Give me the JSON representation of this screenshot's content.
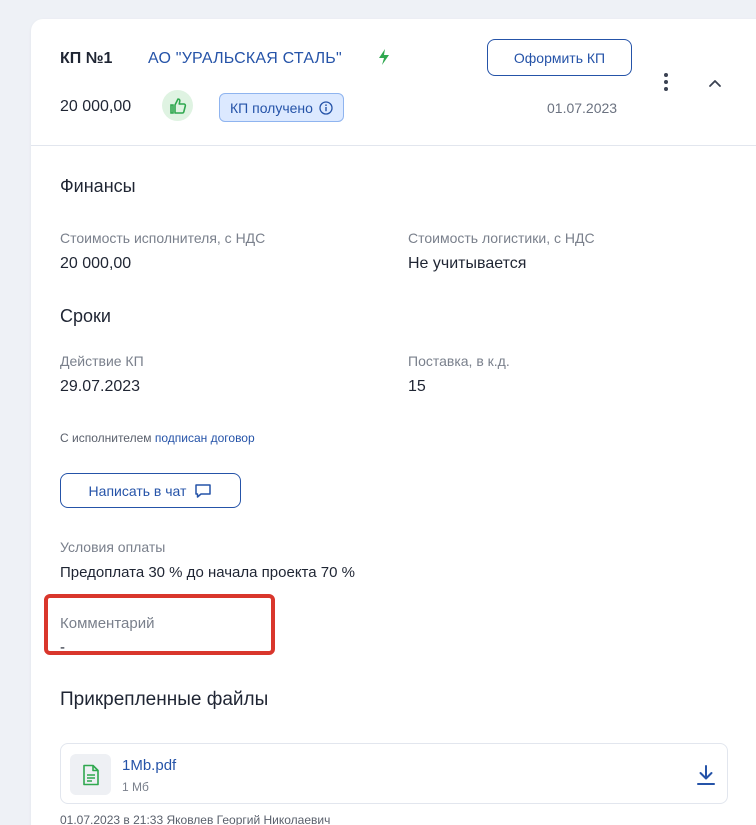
{
  "header": {
    "kp_title": "КП №1",
    "company": "АО \"УРАЛЬСКАЯ СТАЛЬ\"",
    "issue_button": "Оформить КП",
    "price": "20 000,00",
    "status": "КП получено",
    "date": "01.07.2023"
  },
  "finances": {
    "title": "Финансы",
    "executor_cost_label": "Стоимость исполнителя, с НДС",
    "executor_cost_value": "20 000,00",
    "logistics_cost_label": "Стоимость логистики, с НДС",
    "logistics_cost_value": "Не учитывается"
  },
  "terms": {
    "title": "Сроки",
    "validity_label": "Действие КП",
    "validity_value": "29.07.2023",
    "delivery_label": "Поставка, в к.д.",
    "delivery_value": "15",
    "contract_note_prefix": "С исполнителем",
    "contract_note_link": "подписан договор"
  },
  "chat_button": "Написать в чат",
  "payment": {
    "label": "Условия оплаты",
    "value": "Предоплата 30 % до начала проекта 70 %"
  },
  "comment": {
    "label": "Комментарий",
    "value": "-"
  },
  "files": {
    "title": "Прикрепленные файлы",
    "items": [
      {
        "name": "1Mb.pdf",
        "size": "1 Мб",
        "meta": "01.07.2023 в 21:33  Яковлев Георгий Николаевич"
      }
    ]
  },
  "colors": {
    "accent": "#2553a8",
    "success": "#2fa84f",
    "status_bg": "#dce9ff",
    "highlight": "#d9362c"
  },
  "icons": [
    "bolt-icon",
    "thumbs-up-icon",
    "info-icon",
    "more-vertical-icon",
    "chevron-up-icon",
    "chat-icon",
    "file-icon",
    "download-icon"
  ]
}
